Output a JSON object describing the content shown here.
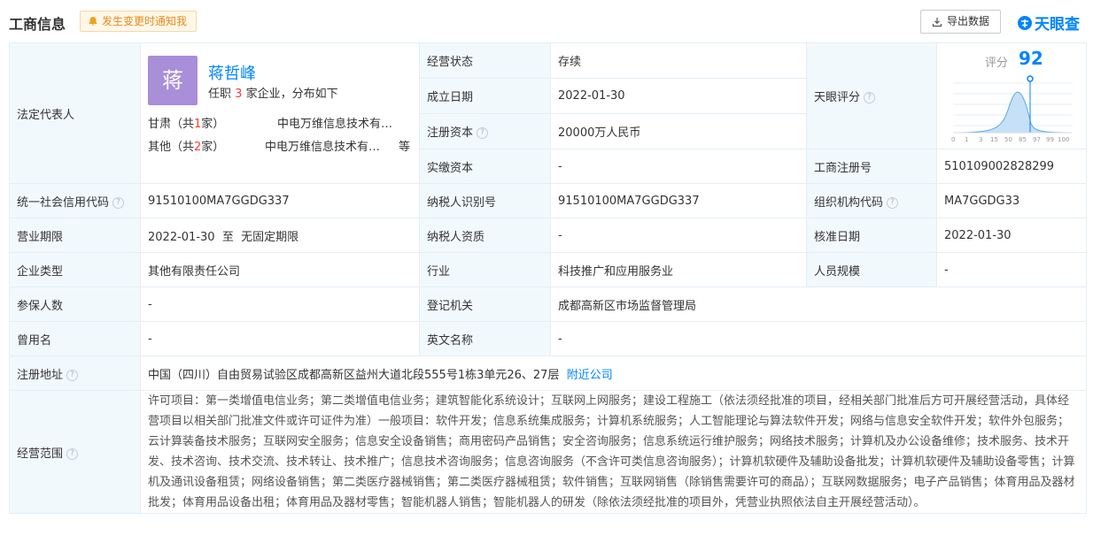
{
  "header": {
    "title": "工商信息",
    "notify_label": "发生变更时通知我",
    "export_label": "导出数据",
    "brand": "天眼查"
  },
  "legal_rep": {
    "label": "法定代表人",
    "avatar_char": "蒋",
    "name": "蒋哲峰",
    "sub_prefix": "任职",
    "sub_count": "3",
    "sub_suffix": "家企业，分布如下",
    "rows": [
      {
        "region": "甘肃（共",
        "count": "1",
        "region_end": "家）",
        "company": "中电万维信息技术有…",
        "more": ""
      },
      {
        "region": "其他（共",
        "count": "2",
        "region_end": "家）",
        "company": "中电万维信息技术有…",
        "more": "等"
      }
    ]
  },
  "fields": {
    "status_label": "经营状态",
    "status": "存续",
    "founded_label": "成立日期",
    "founded": "2022-01-30",
    "capital_label": "注册资本",
    "capital": "20000万人民币",
    "paid_label": "实缴资本",
    "paid": "-",
    "score_label": "天眼评分",
    "regno_label": "工商注册号",
    "regno": "510109002828299",
    "credit_label": "统一社会信用代码",
    "credit": "91510100MA7GGDG337",
    "taxid_label": "纳税人识别号",
    "taxid": "91510100MA7GGDG337",
    "org_label": "组织机构代码",
    "org": "MA7GGDG33",
    "term_label": "营业期限",
    "term": "2022-01-30  至  无固定期限",
    "taxq_label": "纳税人资质",
    "taxq": "-",
    "approve_label": "核准日期",
    "approve": "2022-01-30",
    "type_label": "企业类型",
    "type": "其他有限责任公司",
    "industry_label": "行业",
    "industry": "科技推广和应用服务业",
    "staff_label": "人员规模",
    "staff": "-",
    "insured_label": "参保人数",
    "insured": "-",
    "authority_label": "登记机关",
    "authority": "成都高新区市场监督管理局",
    "former_label": "曾用名",
    "former": "-",
    "en_label": "英文名称",
    "en": "-",
    "addr_label": "注册地址",
    "addr": "中国（四川）自由贸易试验区成都高新区益州大道北段555号1栋3单元26、27层",
    "nearby_label": "附近公司",
    "scope_label": "经营范围",
    "scope": "许可项目：第一类增值电信业务；第二类增值电信业务；建筑智能化系统设计；互联网上网服务；建设工程施工（依法须经批准的项目，经相关部门批准后方可开展经营活动，具体经营项目以相关部门批准文件或许可证件为准）一般项目：软件开发；信息系统集成服务；计算机系统服务；人工智能理论与算法软件开发；网络与信息安全软件开发；软件外包服务；云计算装备技术服务；互联网安全服务；信息安全设备销售；商用密码产品销售；安全咨询服务；信息系统运行维护服务；网络技术服务；计算机及办公设备维修；技术服务、技术开发、技术咨询、技术交流、技术转让、技术推广；信息技术咨询服务；信息咨询服务（不含许可类信息咨询服务）；计算机软硬件及辅助设备批发；计算机软硬件及辅助设备零售；计算机及通讯设备租赁；网络设备销售；第二类医疗器械销售；第二类医疗器械租赁；软件销售；互联网销售（除销售需要许可的商品）；互联网数据服务；电子产品销售；体育用品及器材批发；体育用品设备出租；体育用品及器材零售；智能机器人销售；智能机器人的研发（除依法须经批准的项目外，凭营业执照依法自主开展经营活动）。"
  },
  "score": {
    "label": "评分",
    "value": "92",
    "ticks": [
      "0",
      "1",
      "3",
      "15",
      "50",
      "85",
      "97",
      "99",
      "100"
    ]
  },
  "colors": {
    "accent": "#0084ff",
    "label_bg": "#f2f9fc",
    "border": "#e4eef6"
  }
}
